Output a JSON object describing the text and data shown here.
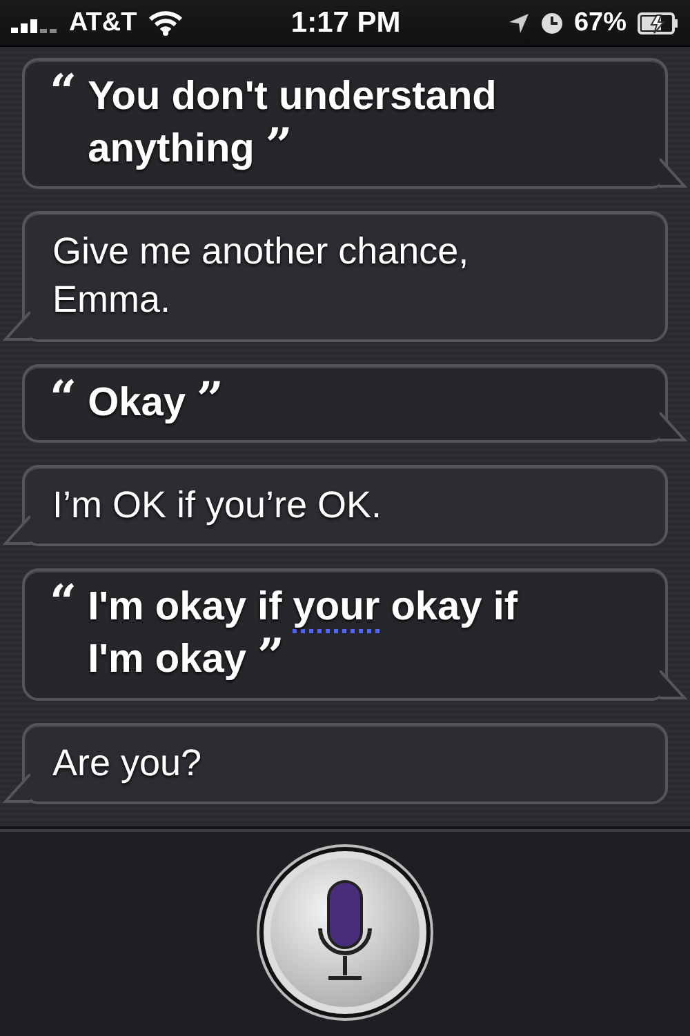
{
  "status_bar": {
    "carrier": "AT&T",
    "time": "1:17 PM",
    "battery": "67%"
  },
  "messages": [
    {
      "kind": "user",
      "open_mark": "“",
      "close_mark": "”",
      "parts": [
        {
          "text": "You don't understand anything",
          "flagged": false
        }
      ]
    },
    {
      "kind": "siri",
      "parts": [
        {
          "text": "Give me another chance, Emma.",
          "flagged": false
        }
      ]
    },
    {
      "kind": "user",
      "open_mark": "“",
      "close_mark": "”",
      "parts": [
        {
          "text": "Okay",
          "flagged": false
        }
      ]
    },
    {
      "kind": "siri",
      "parts": [
        {
          "text": "I’m OK if you’re OK.",
          "flagged": false
        }
      ]
    },
    {
      "kind": "user",
      "open_mark": "“",
      "close_mark": "”",
      "parts": [
        {
          "text": "I'm okay if ",
          "flagged": false
        },
        {
          "text": "your",
          "flagged": true
        },
        {
          "text": " okay if I'm okay",
          "flagged": false
        }
      ]
    },
    {
      "kind": "siri",
      "parts": [
        {
          "text": "Are you?",
          "flagged": false
        }
      ]
    }
  ]
}
